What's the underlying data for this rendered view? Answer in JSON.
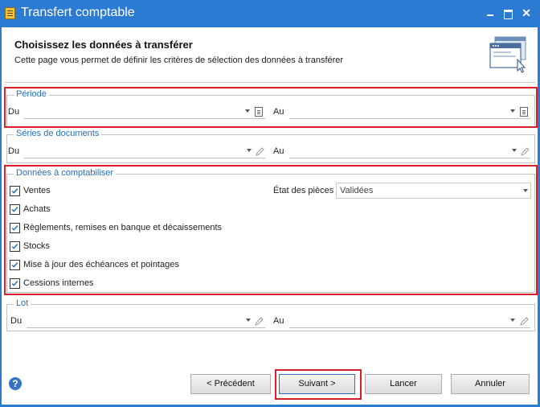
{
  "window": {
    "title": "Transfert comptable",
    "controls": {
      "minimize": "minimize-icon",
      "maximize": "maximize-icon",
      "close": "✕"
    }
  },
  "header": {
    "title": "Choisissez les données à transférer",
    "subtitle": "Cette page vous permet de définir les critères de sélection des données à transférer",
    "illustration": "window-cursor-icon"
  },
  "periode": {
    "legend": "Période",
    "from_label": "Du",
    "to_label": "Au",
    "from_value": "",
    "to_value": ""
  },
  "series": {
    "legend": "Séries de documents",
    "from_label": "Du",
    "to_label": "Au",
    "from_value": "",
    "to_value": ""
  },
  "donnees": {
    "legend": "Données à comptabiliser",
    "items": [
      {
        "label": "Ventes",
        "checked": true
      },
      {
        "label": "Achats",
        "checked": true
      },
      {
        "label": "Règlements, remises en banque et décaissements",
        "checked": true
      },
      {
        "label": "Stocks",
        "checked": true
      },
      {
        "label": "Mise à jour des échéances et pointages",
        "checked": true
      },
      {
        "label": "Cessions internes",
        "checked": true
      }
    ],
    "etat_label": "État des pièces",
    "etat_value": "Validées"
  },
  "lot": {
    "legend": "Lot",
    "from_label": "Du",
    "to_label": "Au",
    "from_value": "",
    "to_value": ""
  },
  "footer": {
    "help": "?",
    "buttons": {
      "previous": "< Précédent",
      "next": "Suivant >",
      "launch": "Lancer",
      "cancel": "Annuler"
    }
  },
  "colors": {
    "titlebar": "#2b7bd3",
    "legend": "#2a6fb5",
    "highlight": "#d9202a",
    "check": "#2a6fb5"
  }
}
